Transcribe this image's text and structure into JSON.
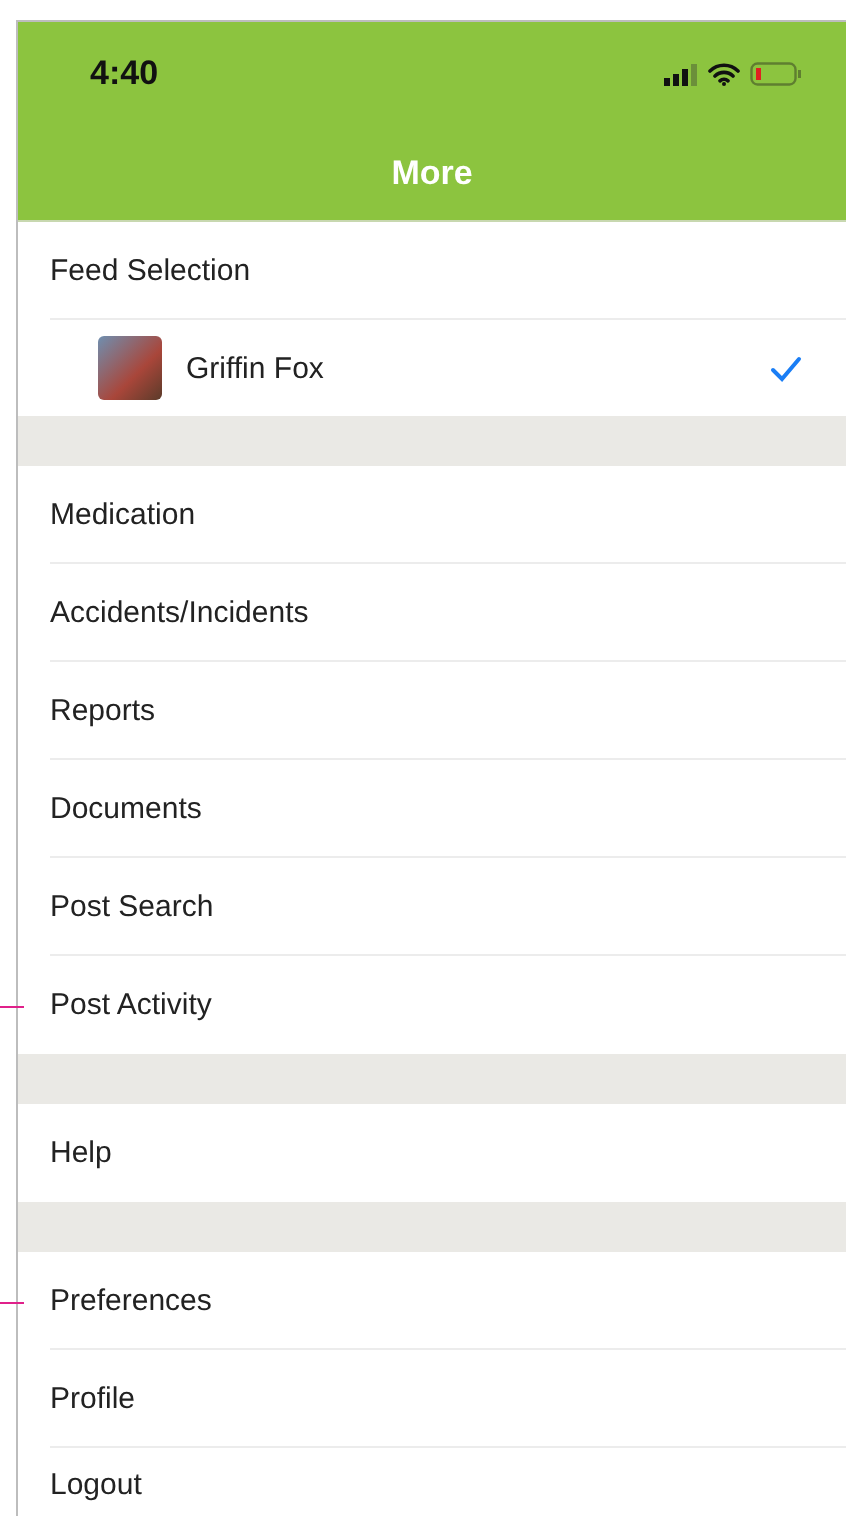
{
  "status_bar": {
    "time": "4:40"
  },
  "nav_bar": {
    "title": "More"
  },
  "feed_selection": {
    "title": "Feed Selection",
    "feeds": [
      {
        "name": "Griffin Fox",
        "selected": true
      }
    ]
  },
  "menu_groups": [
    {
      "items": [
        {
          "label": "Medication",
          "marked": false
        },
        {
          "label": "Accidents/Incidents",
          "marked": false
        },
        {
          "label": "Reports",
          "marked": false
        },
        {
          "label": "Documents",
          "marked": false
        },
        {
          "label": "Post Search",
          "marked": false
        },
        {
          "label": "Post Activity",
          "marked": true
        }
      ]
    },
    {
      "items": [
        {
          "label": "Help",
          "marked": false
        }
      ]
    },
    {
      "items": [
        {
          "label": "Preferences",
          "marked": true
        },
        {
          "label": "Profile",
          "marked": false
        },
        {
          "label": "Logout",
          "marked": false
        }
      ]
    }
  ]
}
